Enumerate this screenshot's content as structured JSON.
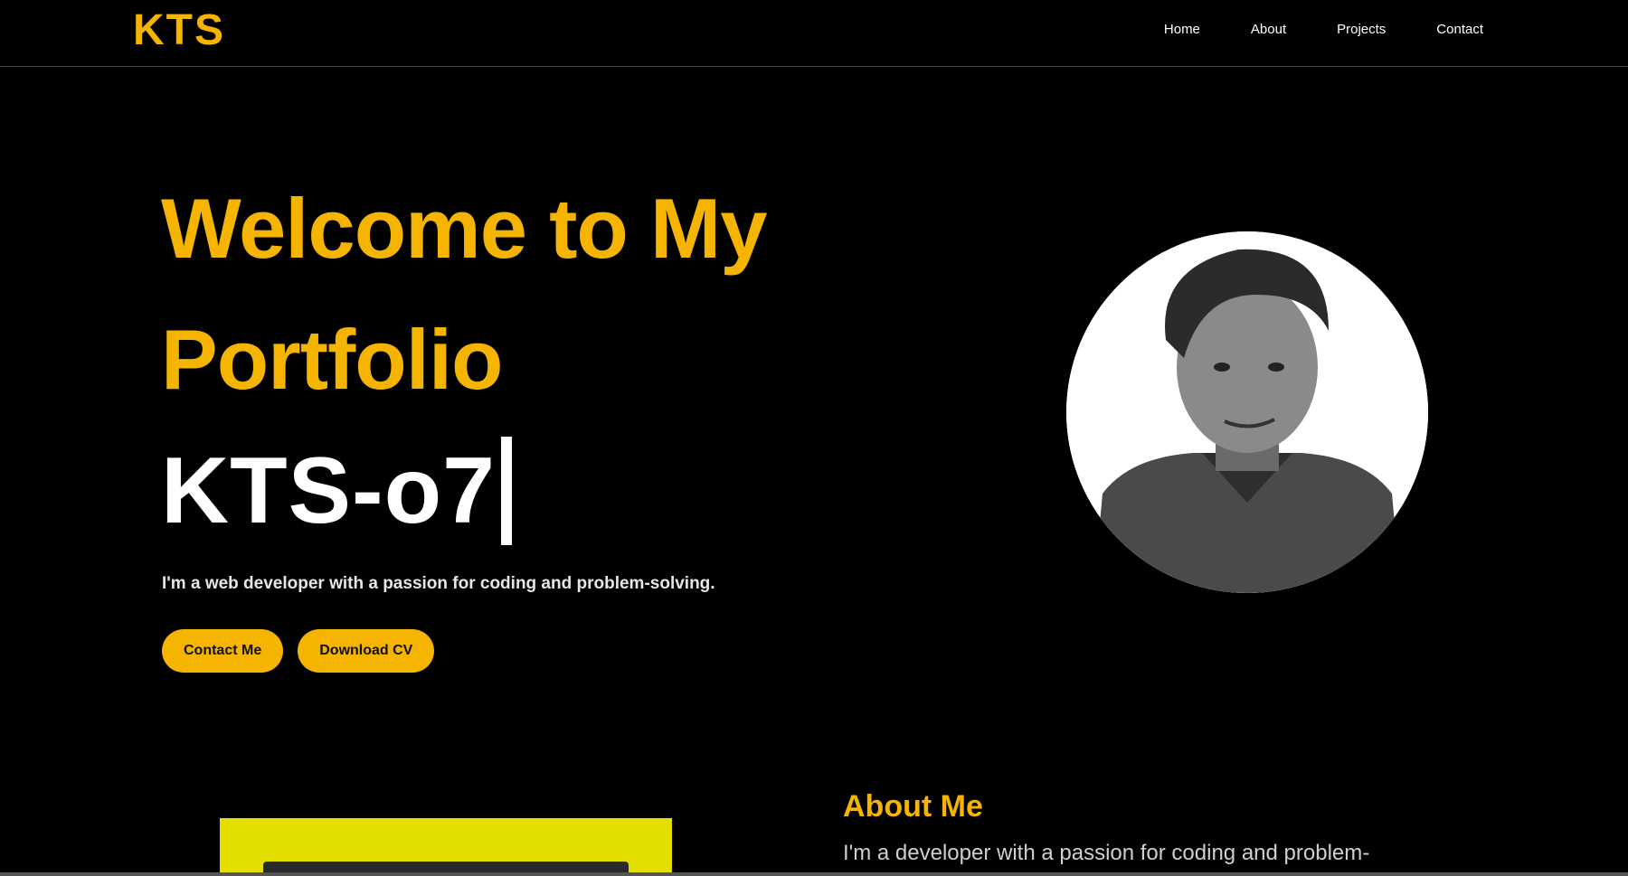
{
  "header": {
    "logo": "KTS",
    "nav": [
      {
        "label": "Home"
      },
      {
        "label": "About"
      },
      {
        "label": "Projects"
      },
      {
        "label": "Contact"
      }
    ]
  },
  "hero": {
    "title_line1": "Welcome to My",
    "title_line2": "Portfolio",
    "typed_name": "KTS-o7",
    "tagline": "I'm a web developer with a passion for coding and problem-solving.",
    "buttons": {
      "contact": "Contact Me",
      "download": "Download CV"
    }
  },
  "about": {
    "title": "About Me",
    "text": "I'm a developer with a passion for coding and problem-"
  },
  "colors": {
    "accent": "#f5b400",
    "background": "#000000",
    "text": "#ffffff",
    "about_frame": "#e2de00"
  }
}
